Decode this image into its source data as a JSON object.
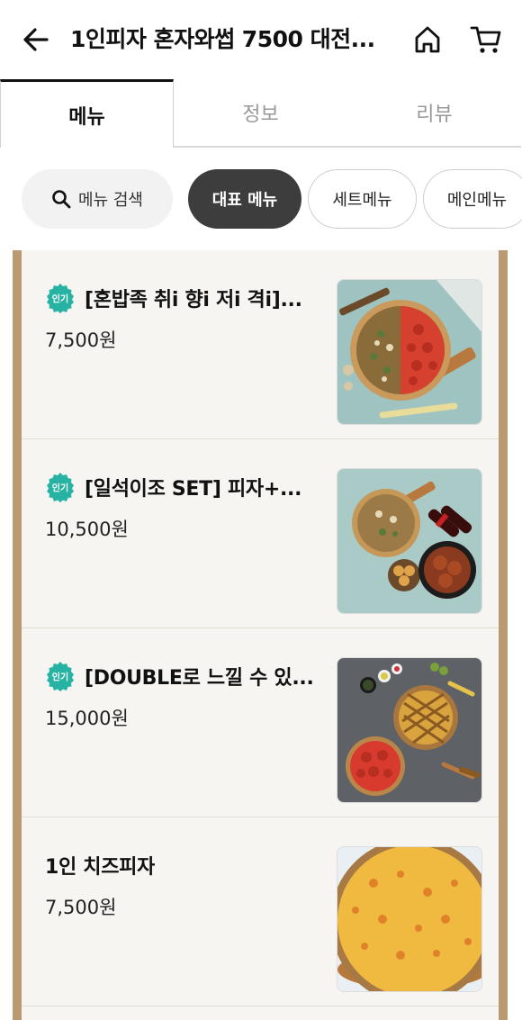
{
  "header": {
    "title": "1인피자 혼자와썹 7500 대전..."
  },
  "tabs": [
    {
      "label": "메뉴"
    },
    {
      "label": "정보"
    },
    {
      "label": "리뷰"
    }
  ],
  "chips": {
    "search_label": "메뉴 검색",
    "items": [
      "대표 메뉴",
      "세트메뉴",
      "메인메뉴"
    ]
  },
  "badge_text": "인기",
  "menu_items": [
    {
      "name": "[혼밥족 취i 향i 저i 격i]...",
      "price": "7,500원",
      "popular": true
    },
    {
      "name": "[일석이조 SET] 피자+...",
      "price": "10,500원",
      "popular": true
    },
    {
      "name": "[DOUBLE로 느낄 수 있...",
      "price": "15,000원",
      "popular": true
    },
    {
      "name": "1인 치즈피자",
      "price": "7,500원",
      "popular": false
    }
  ],
  "colors": {
    "accent_badge": "#27b3a3",
    "chip_active": "#3d3d3d",
    "frame": "#b99a72"
  }
}
